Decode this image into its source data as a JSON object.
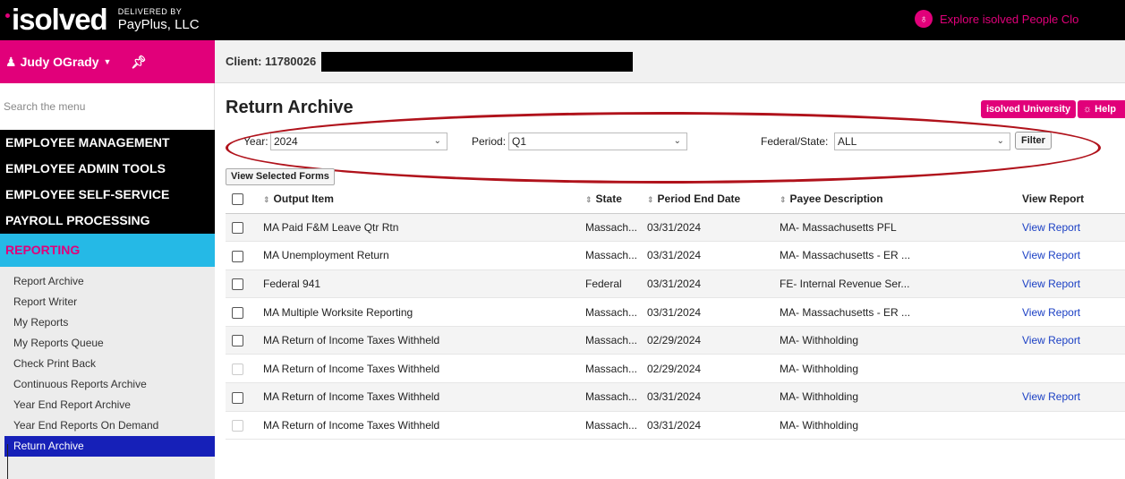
{
  "header": {
    "logo": "isolved",
    "delivered_by": "DELIVERED BY",
    "partner": "PayPlus, LLC",
    "explore": "Explore isolved People Clo"
  },
  "user": {
    "name": "Judy OGrady"
  },
  "client": {
    "label": "Client: 11780026"
  },
  "sidebar": {
    "search_placeholder": "Search the menu",
    "sections": [
      "EMPLOYEE MANAGEMENT",
      "EMPLOYEE ADMIN TOOLS",
      "EMPLOYEE SELF-SERVICE",
      "PAYROLL PROCESSING"
    ],
    "reporting": "REPORTING",
    "items": [
      "Report Archive",
      "Report Writer",
      "My Reports",
      "My Reports Queue",
      "Check Print Back",
      "Continuous Reports Archive",
      "Year End Report Archive",
      "Year End Reports On Demand",
      "Return Archive"
    ]
  },
  "page": {
    "title": "Return Archive",
    "university_btn": "isolved University",
    "help_btn": "Help"
  },
  "filters": {
    "year_label": "Year:",
    "year_value": "2024",
    "period_label": "Period:",
    "period_value": "Q1",
    "fedstate_label": "Federal/State:",
    "fedstate_value": "ALL",
    "filter_btn": "Filter",
    "view_selected": "View Selected Forms"
  },
  "table": {
    "headers": [
      "Output Item",
      "State",
      "Period End Date",
      "Payee Description",
      "View Report"
    ],
    "rows": [
      {
        "item": "MA Paid F&M Leave Qtr Rtn",
        "state": "Massach...",
        "date": "03/31/2024",
        "payee": "MA- Massachusetts PFL",
        "view": "View Report"
      },
      {
        "item": "MA Unemployment Return",
        "state": "Massach...",
        "date": "03/31/2024",
        "payee": "MA- Massachusetts - ER ...",
        "view": "View Report"
      },
      {
        "item": "Federal 941",
        "state": "Federal",
        "date": "03/31/2024",
        "payee": "FE- Internal Revenue Ser...",
        "view": "View Report"
      },
      {
        "item": "MA Multiple Worksite Reporting",
        "state": "Massach...",
        "date": "03/31/2024",
        "payee": "MA- Massachusetts - ER ...",
        "view": "View Report"
      },
      {
        "item": "MA Return of Income Taxes Withheld",
        "state": "Massach...",
        "date": "02/29/2024",
        "payee": "MA- Withholding",
        "view": "View Report"
      },
      {
        "item": "MA Return of Income Taxes Withheld",
        "state": "Massach...",
        "date": "02/29/2024",
        "payee": "MA- Withholding",
        "view": ""
      },
      {
        "item": "MA Return of Income Taxes Withheld",
        "state": "Massach...",
        "date": "03/31/2024",
        "payee": "MA- Withholding",
        "view": "View Report"
      },
      {
        "item": "MA Return of Income Taxes Withheld",
        "state": "Massach...",
        "date": "03/31/2024",
        "payee": "MA- Withholding",
        "view": ""
      }
    ]
  },
  "colors": {
    "brand_pink": "#e1007a",
    "reporting_blue": "#25b9e6",
    "active_navy": "#1620b8",
    "annotation_red": "#b0121b"
  }
}
